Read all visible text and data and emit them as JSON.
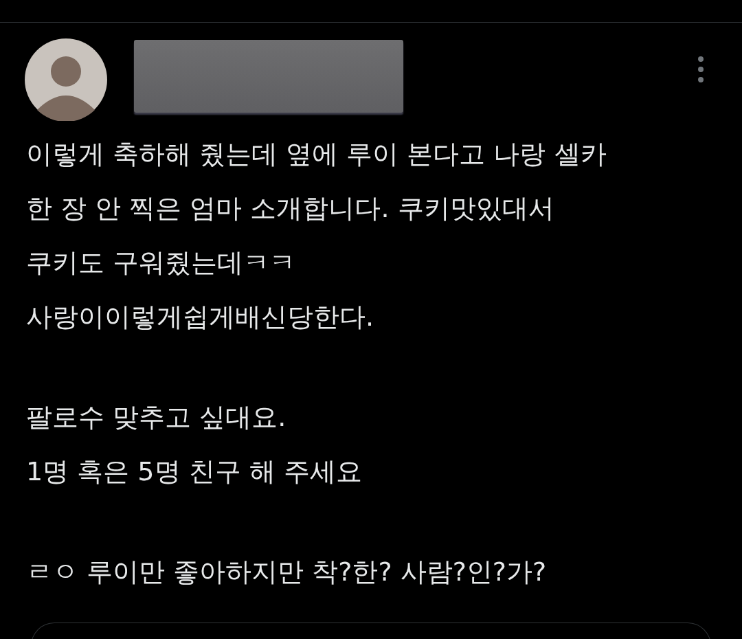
{
  "post": {
    "paragraphs": [
      "이렇게 축하해 줬는데 옆에 루이 본다고 나랑 셀카\n한 장 안 찍은 엄마 소개합니다. 쿠키맛있대서\n쿠키도 구워줬는데ㅋㅋ\n사랑이이렇게쉽게배신당한다.",
      "팔로수 맞추고 싶대요.\n1명 혹은 5명 친구 해 주세요",
      "ㄹㅇ 루이만 좋아하지만 착?한? 사람?인?가?"
    ]
  }
}
